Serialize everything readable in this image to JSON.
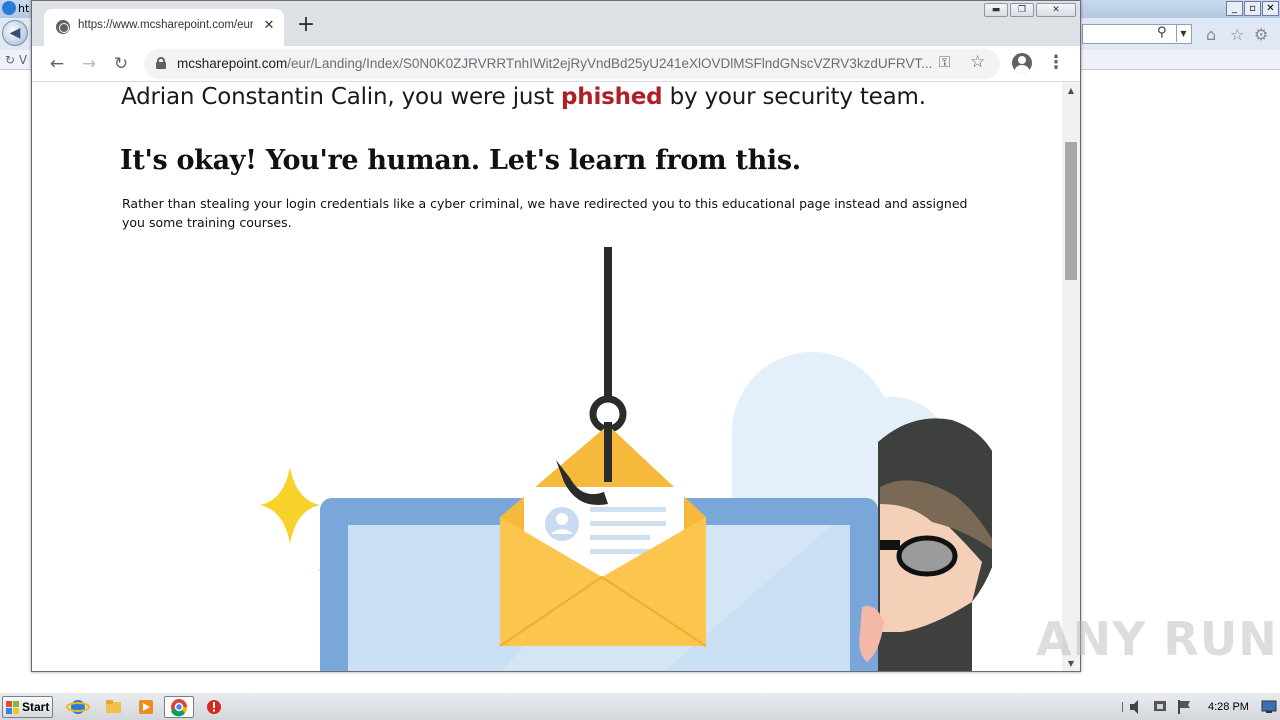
{
  "ie": {
    "title": "ht",
    "tab_label": "V"
  },
  "chrome": {
    "tab_title": "https://www.mcsharepoint.com/eur/",
    "url_host": "mcsharepoint.com",
    "url_path": "/eur/Landing/Index/S0N0K0ZJRVRRTnhIWit2ejRyVndBd25yU241eXlOVDlMSFlndGNscVZRV3kzdUFRVT..."
  },
  "page": {
    "headline_before": "Adrian Constantin Calin, you were just ",
    "headline_highlight": "phished",
    "headline_after": " by your security team.",
    "subhead": "It's okay! You're human. Let's learn from this.",
    "body": "Rather than stealing your login credentials like a cyber criminal, we have redirected you to this educational page instead and assigned you some training courses."
  },
  "taskbar": {
    "start_label": "Start",
    "clock": "4:28 PM"
  },
  "watermark": "ANY RUN",
  "colors": {
    "phished": "#b01f28",
    "laptop_frame": "#7aa7d9",
    "laptop_screen": "#c9dff3",
    "envelope": "#fcc54e",
    "sparkle": "#f9d12b",
    "hacker_hood": "#3d403c"
  },
  "icons": {
    "tab_favicon": "globe-icon",
    "lock": "lock-icon",
    "key": "key-icon",
    "star": "star-icon",
    "account": "account-icon",
    "menu": "more-vert-icon"
  }
}
